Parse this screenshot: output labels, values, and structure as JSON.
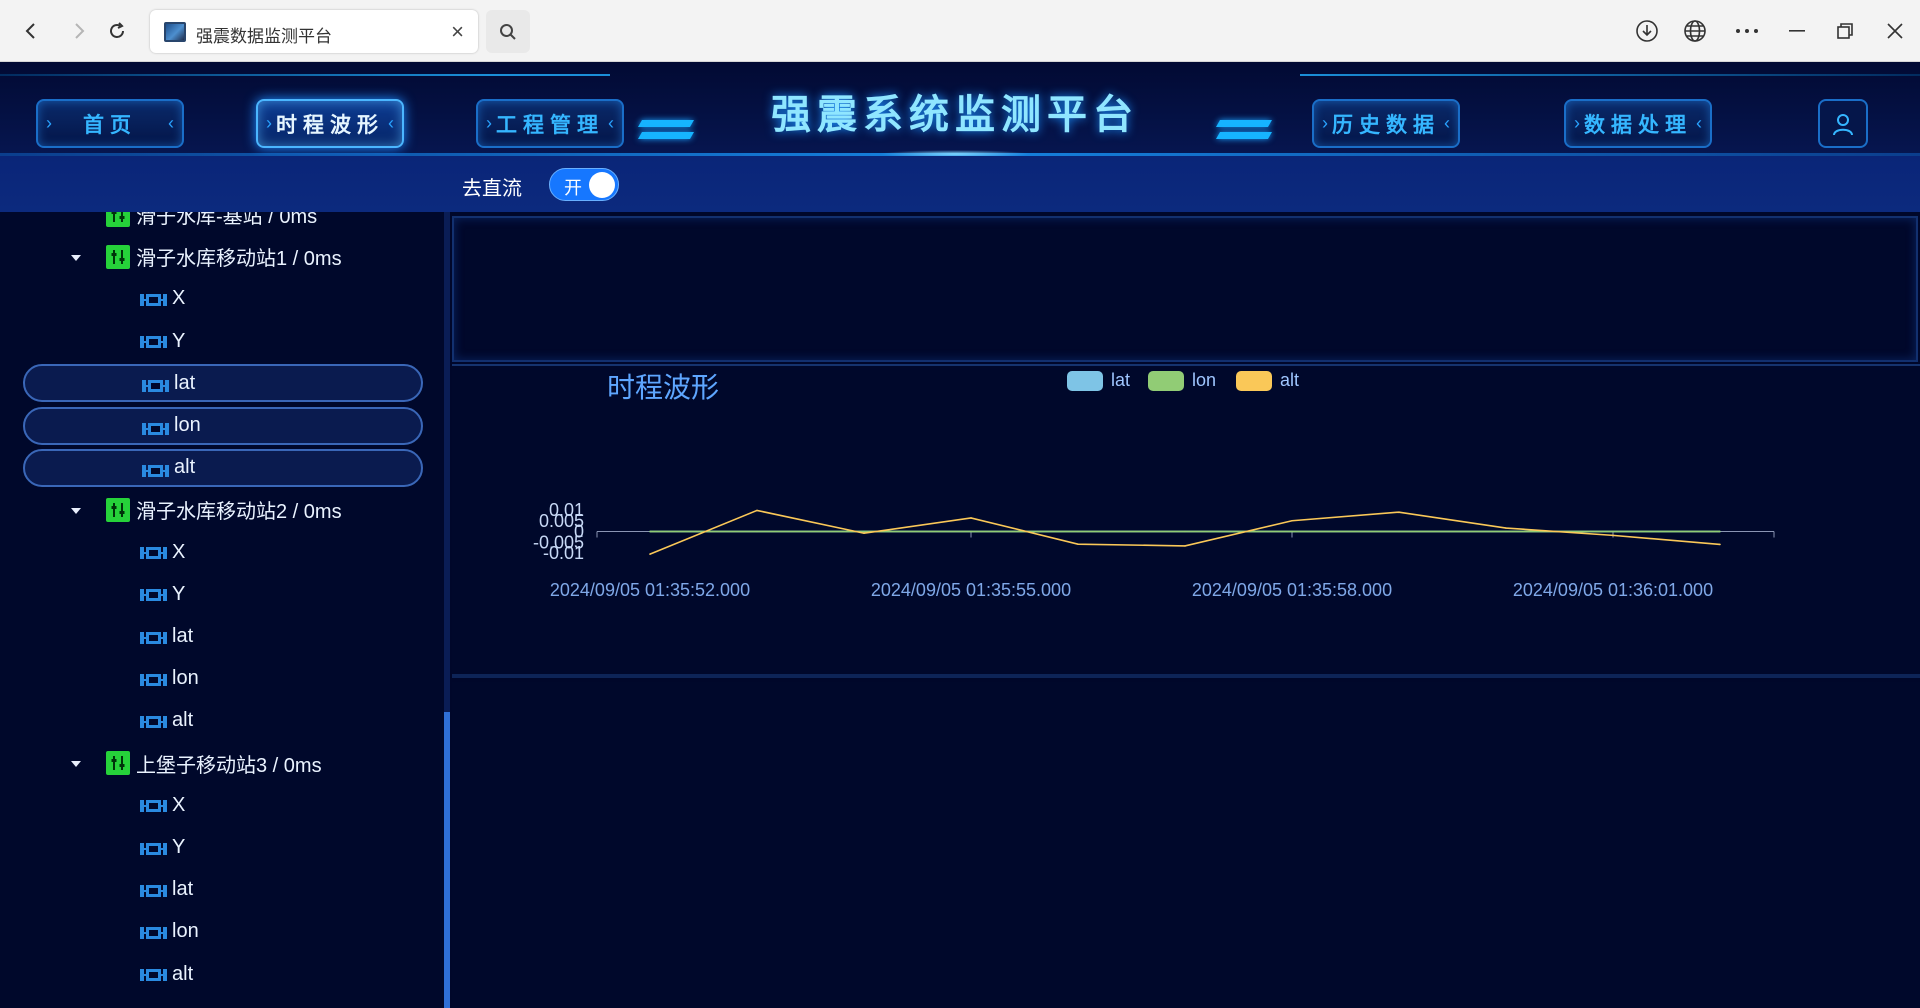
{
  "browser": {
    "tab_title": "强震数据监测平台",
    "close_glyph": "×"
  },
  "header": {
    "app_title": "强震系统监测平台",
    "nav": [
      {
        "label": "首页"
      },
      {
        "label": "时程波形",
        "active": true
      },
      {
        "label": "工程管理"
      },
      {
        "label": "历史数据"
      },
      {
        "label": "数据处理"
      }
    ]
  },
  "toolbar": {
    "dc_label": "去直流",
    "toggle_text": "开",
    "toggle_on": true
  },
  "tree": {
    "stations": [
      {
        "label": "滑子水库-基站 / 0ms",
        "expanded": false,
        "channels": []
      },
      {
        "label": "滑子水库移动站1 / 0ms",
        "expanded": true,
        "channels": [
          {
            "label": "X",
            "selected": false
          },
          {
            "label": "Y",
            "selected": false
          },
          {
            "label": "lat",
            "selected": true
          },
          {
            "label": "lon",
            "selected": true
          },
          {
            "label": "alt",
            "selected": true
          }
        ]
      },
      {
        "label": "滑子水库移动站2 / 0ms",
        "expanded": true,
        "channels": [
          {
            "label": "X",
            "selected": false
          },
          {
            "label": "Y",
            "selected": false
          },
          {
            "label": "lat",
            "selected": false
          },
          {
            "label": "lon",
            "selected": false
          },
          {
            "label": "alt",
            "selected": false
          }
        ]
      },
      {
        "label": "上堡子移动站3 / 0ms",
        "expanded": true,
        "channels": [
          {
            "label": "X",
            "selected": false
          },
          {
            "label": "Y",
            "selected": false
          },
          {
            "label": "lat",
            "selected": false
          },
          {
            "label": "lon",
            "selected": false
          },
          {
            "label": "alt",
            "selected": false
          }
        ]
      }
    ]
  },
  "colors": {
    "accent": "#1677ff",
    "lat": "#7ec4e6",
    "lon": "#91cc75",
    "alt": "#fac858"
  },
  "chart_data": {
    "type": "line",
    "title": "时程波形",
    "legend": [
      "lat",
      "lon",
      "alt"
    ],
    "legend_position": "top-center",
    "ylim": [
      -0.01,
      0.01
    ],
    "y_ticks": [
      "0.01",
      "0.005",
      "0",
      "-0.005",
      "-0.01"
    ],
    "x_ticks": [
      "2024/09/05 01:35:52.000",
      "2024/09/05 01:35:55.000",
      "2024/09/05 01:35:58.000",
      "2024/09/05 01:36:01.000"
    ],
    "x": [
      "2024/09/05 01:35:52.000",
      "2024/09/05 01:35:53.000",
      "2024/09/05 01:35:54.000",
      "2024/09/05 01:35:55.000",
      "2024/09/05 01:35:56.000",
      "2024/09/05 01:35:57.000",
      "2024/09/05 01:35:58.000",
      "2024/09/05 01:35:59.000",
      "2024/09/05 01:36:00.000",
      "2024/09/05 01:36:01.000",
      "2024/09/05 01:36:02.000"
    ],
    "series": [
      {
        "name": "lat",
        "values": [
          0,
          0,
          0,
          0,
          0,
          0,
          0,
          0,
          0,
          0,
          0
        ]
      },
      {
        "name": "lon",
        "values": [
          0,
          0,
          0,
          0,
          0,
          0,
          0,
          0,
          0,
          0,
          0
        ]
      },
      {
        "name": "alt",
        "values": [
          -0.0105,
          0.0098,
          -0.0008,
          0.0063,
          -0.0059,
          -0.0067,
          0.005,
          0.009,
          0.0016,
          -0.0018,
          -0.006
        ]
      }
    ],
    "grid": false
  }
}
